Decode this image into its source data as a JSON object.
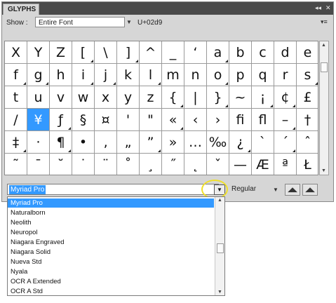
{
  "panel": {
    "tab_title": "GLYPHS",
    "collapse_icon": "double-chevron-left-icon",
    "close_icon": "close-icon",
    "menu_icon": "panel-menu-icon"
  },
  "show": {
    "label": "Show :",
    "value": "Entire Font",
    "code": "U+02d9"
  },
  "glyphs": [
    {
      "g": "X",
      "t": false
    },
    {
      "g": "Y",
      "t": false
    },
    {
      "g": "Z",
      "t": false
    },
    {
      "g": "[",
      "t": true
    },
    {
      "g": "\\",
      "t": false
    },
    {
      "g": "]",
      "t": true
    },
    {
      "g": "^",
      "t": false
    },
    {
      "g": "_",
      "t": false
    },
    {
      "g": "‘",
      "t": false
    },
    {
      "g": "a",
      "t": true
    },
    {
      "g": "b",
      "t": false
    },
    {
      "g": "c",
      "t": false
    },
    {
      "g": "d",
      "t": false
    },
    {
      "g": "e",
      "t": false
    },
    {
      "g": "f",
      "t": true
    },
    {
      "g": "g",
      "t": true
    },
    {
      "g": "h",
      "t": false
    },
    {
      "g": "i",
      "t": true
    },
    {
      "g": "j",
      "t": true
    },
    {
      "g": "k",
      "t": false
    },
    {
      "g": "l",
      "t": true
    },
    {
      "g": "m",
      "t": false
    },
    {
      "g": "n",
      "t": false
    },
    {
      "g": "o",
      "t": true
    },
    {
      "g": "p",
      "t": false
    },
    {
      "g": "q",
      "t": false
    },
    {
      "g": "r",
      "t": false
    },
    {
      "g": "s",
      "t": true
    },
    {
      "g": "t",
      "t": false
    },
    {
      "g": "u",
      "t": false
    },
    {
      "g": "v",
      "t": false
    },
    {
      "g": "w",
      "t": false
    },
    {
      "g": "x",
      "t": false
    },
    {
      "g": "y",
      "t": false
    },
    {
      "g": "z",
      "t": false
    },
    {
      "g": "{",
      "t": true
    },
    {
      "g": "|",
      "t": false
    },
    {
      "g": "}",
      "t": true
    },
    {
      "g": "~",
      "t": false
    },
    {
      "g": "¡",
      "t": true
    },
    {
      "g": "¢",
      "t": true
    },
    {
      "g": "£",
      "t": false
    },
    {
      "g": "/",
      "t": false
    },
    {
      "g": "¥",
      "t": false,
      "sel": true
    },
    {
      "g": "ƒ",
      "t": true
    },
    {
      "g": "§",
      "t": false
    },
    {
      "g": "¤",
      "t": false
    },
    {
      "g": "'",
      "t": false
    },
    {
      "g": "\"",
      "t": false
    },
    {
      "g": "«",
      "t": true
    },
    {
      "g": "‹",
      "t": false
    },
    {
      "g": "›",
      "t": false
    },
    {
      "g": "ﬁ",
      "t": false
    },
    {
      "g": "ﬂ",
      "t": false
    },
    {
      "g": "–",
      "t": true
    },
    {
      "g": "†",
      "t": false
    },
    {
      "g": "‡",
      "t": true
    },
    {
      "g": "·",
      "t": false
    },
    {
      "g": "¶",
      "t": true
    },
    {
      "g": "•",
      "t": false
    },
    {
      "g": "‚",
      "t": false
    },
    {
      "g": "„",
      "t": false
    },
    {
      "g": "”",
      "t": true
    },
    {
      "g": "»",
      "t": false
    },
    {
      "g": "…",
      "t": false
    },
    {
      "g": "‰",
      "t": false
    },
    {
      "g": "¿",
      "t": true
    },
    {
      "g": "`",
      "t": false
    },
    {
      "g": "´",
      "t": true
    },
    {
      "g": "ˆ",
      "t": false
    },
    {
      "g": "˜",
      "t": false
    },
    {
      "g": "¯",
      "t": false
    },
    {
      "g": "˘",
      "t": false
    },
    {
      "g": "˙",
      "t": false
    },
    {
      "g": "¨",
      "t": false
    },
    {
      "g": "˚",
      "t": false
    },
    {
      "g": "¸",
      "t": false
    },
    {
      "g": "˝",
      "t": false
    },
    {
      "g": "˛",
      "t": false
    },
    {
      "g": "ˇ",
      "t": false
    },
    {
      "g": "—",
      "t": false
    },
    {
      "g": "Æ",
      "t": false
    },
    {
      "g": "ª",
      "t": false
    },
    {
      "g": "Ł",
      "t": false
    }
  ],
  "font": {
    "family": "Myriad Pro",
    "style": "Regular"
  },
  "font_list": [
    "Myriad Pro",
    "Naturalborn",
    "Neolith",
    "Neuropol",
    "Niagara Engraved",
    "Niagara Solid",
    "Nueva Std",
    "Nyala",
    "OCR A Extended",
    "OCR A Std"
  ],
  "colors": {
    "selection": "#3399ff",
    "highlight_circle": "#f0e02a"
  }
}
